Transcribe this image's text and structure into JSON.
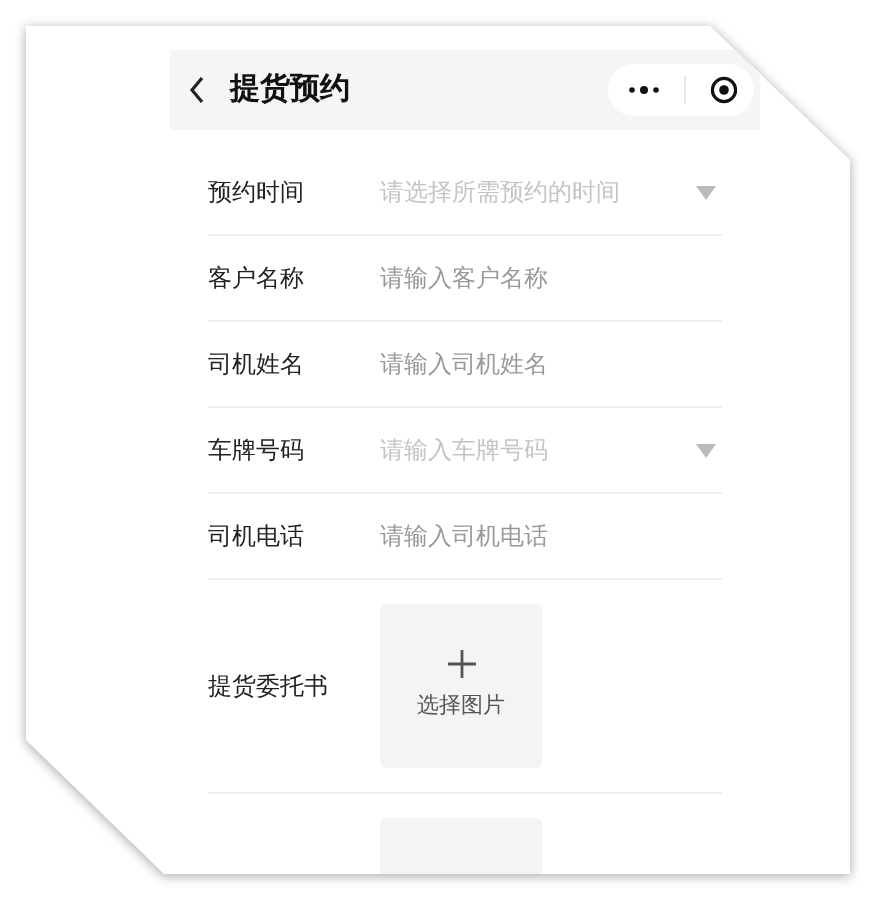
{
  "header": {
    "title": "提货预约"
  },
  "fields": [
    {
      "kind": "select",
      "label": "预约时间",
      "placeholder": "请选择所需预约的时间"
    },
    {
      "kind": "input",
      "label": "客户名称",
      "placeholder": "请输入客户名称"
    },
    {
      "kind": "input",
      "label": "司机姓名",
      "placeholder": "请输入司机姓名"
    },
    {
      "kind": "select",
      "label": "车牌号码",
      "placeholder": "请输入车牌号码"
    },
    {
      "kind": "input",
      "label": "司机电话",
      "placeholder": "请输入司机电话"
    },
    {
      "kind": "upload",
      "label": "提货委托书",
      "button": "选择图片"
    },
    {
      "kind": "upload"
    }
  ]
}
